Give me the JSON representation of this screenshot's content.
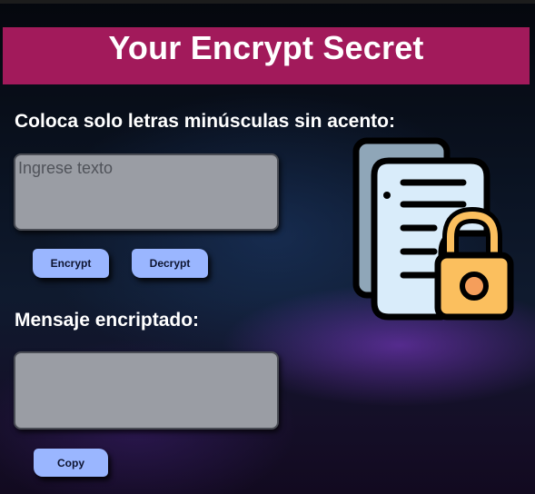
{
  "header": {
    "title": "Your Encrypt Secret"
  },
  "input_section": {
    "label": "Coloca solo letras minúsculas sin acento:",
    "placeholder": "Ingrese texto",
    "value": ""
  },
  "actions": {
    "encrypt_label": "Encrypt",
    "decrypt_label": "Decrypt"
  },
  "output_section": {
    "label": "Mensaje encriptado:",
    "value": "",
    "copy_label": "Copy"
  },
  "illustration": {
    "icon": "document-lock-icon"
  },
  "colors": {
    "banner": "#a21a5b",
    "button": "#9ab6ff",
    "textbox": "#9a9da4",
    "lock_body": "#fbbf5e",
    "document": "#d9ecfa"
  }
}
